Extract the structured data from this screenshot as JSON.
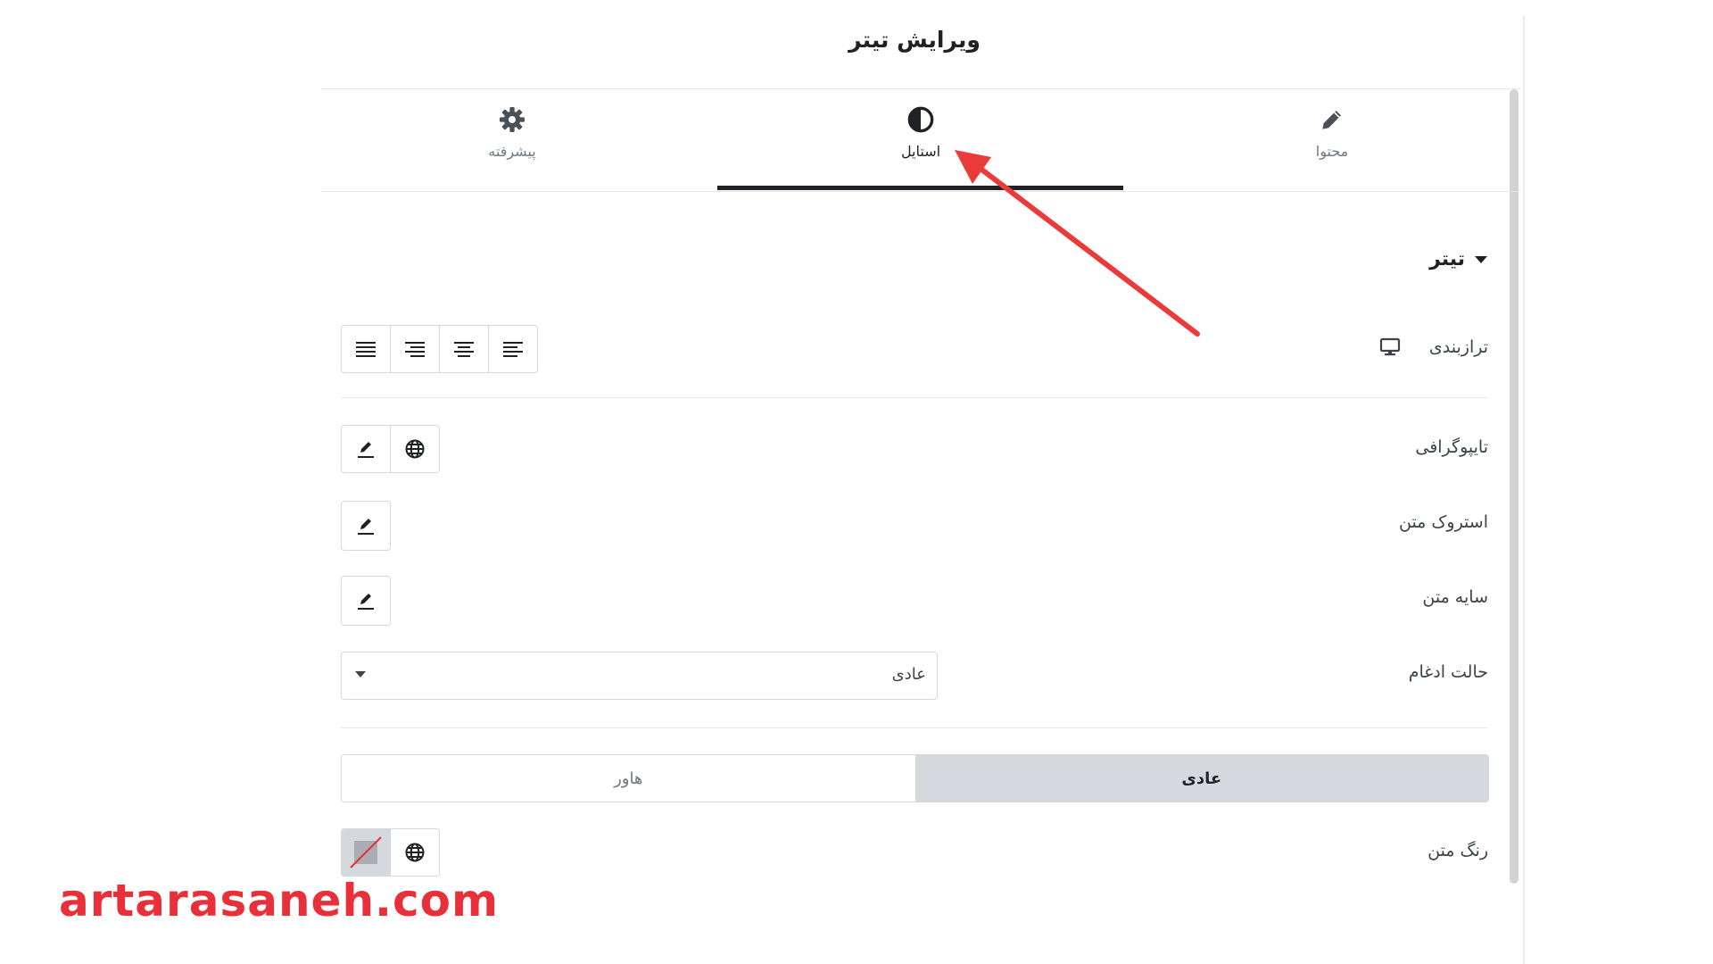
{
  "panel": {
    "title": "ویرایش تیتر"
  },
  "tabs": [
    {
      "label": "محتوا",
      "icon": "pencil-icon",
      "active": false
    },
    {
      "label": "استایل",
      "icon": "contrast-icon",
      "active": true
    },
    {
      "label": "پیشرفته",
      "icon": "gear-icon",
      "active": false
    }
  ],
  "section": {
    "title": "تیتر",
    "icon": "caret-down-icon"
  },
  "controls": {
    "alignment": {
      "label": "ترازبندی",
      "device_icon": "desktop-icon",
      "options": [
        "justify-icon",
        "align-right-icon",
        "align-center-icon",
        "align-left-icon"
      ]
    },
    "typography": {
      "label": "تایپوگرافی"
    },
    "text_stroke": {
      "label": "استروک متن"
    },
    "text_shadow": {
      "label": "سایه متن"
    },
    "blend_mode": {
      "label": "حالت ادغام",
      "value": "عادی"
    },
    "state_tabs": {
      "normal": "عادی",
      "hover": "هاور"
    },
    "text_color": {
      "label": "رنگ متن"
    }
  },
  "annotation": {
    "arrow_color": "#ea3b3b"
  },
  "watermark": {
    "text": "artarasaneh.com",
    "color": "#e8303a"
  },
  "colors": {
    "active_tab": "#1f2124",
    "muted": "#6d7882",
    "border": "#d5d8dc",
    "toggle_on": "#d5d8dc"
  }
}
